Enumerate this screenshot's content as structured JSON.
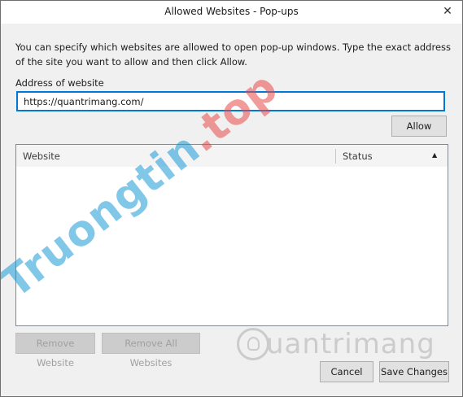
{
  "window": {
    "title": "Allowed Websites - Pop-ups",
    "close_symbol": "✕"
  },
  "description": "You can specify which websites are allowed to open pop-up windows. Type the exact address of the site you want to allow and then click Allow.",
  "address": {
    "label": "Address of website",
    "value": "https://quantrimang.com/"
  },
  "buttons": {
    "allow": "Allow",
    "remove_website": "Remove Website",
    "remove_all": "Remove All Websites",
    "cancel": "Cancel",
    "save": "Save Changes"
  },
  "table": {
    "columns": [
      {
        "label": "Website"
      },
      {
        "label": "Status",
        "sort": "ascending"
      }
    ],
    "sort_symbol": "▲",
    "rows": []
  },
  "watermarks": {
    "left_blue": "Truongtin",
    "left_red": ".top",
    "right": "uantrimang"
  },
  "colors": {
    "focus_border": "#0078d7",
    "watermark_blue": "#1a9bd7",
    "watermark_red": "#e84b4b"
  }
}
